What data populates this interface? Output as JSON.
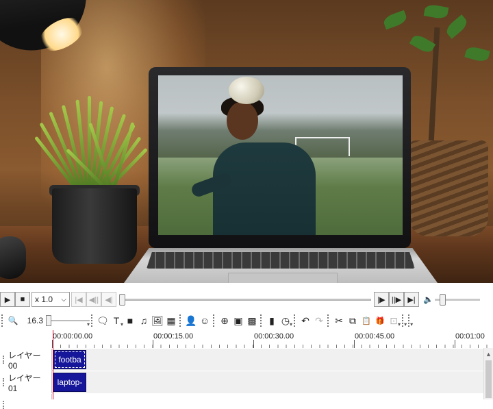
{
  "preview": {
    "description_icon": "video-preview"
  },
  "playback": {
    "speed": "x 1.0",
    "speed_caret": "⌵",
    "play_icon": "▶",
    "stop_icon": "■",
    "prev_icon": "|◀",
    "prev_frame_icon": "◀||",
    "step_back_icon": "◀|",
    "next_icon": "|▶",
    "next_frame_icon": "||▶",
    "end_icon": "▶|",
    "volume_icon": "🔈",
    "seek_position": 0.0,
    "volume_level": 0.12
  },
  "toolbar": {
    "zoom_icon": "🔍",
    "zoom_value": "16.3",
    "zoom_level": 0.0,
    "icons": {
      "subtitle": "🗨",
      "text": "T",
      "video": "■",
      "audio": "♫",
      "image": "🖼",
      "shapes": "▦",
      "person": "👤",
      "face": "☺",
      "add": "⊕",
      "picture": "▣",
      "mosaic": "▩",
      "bookmark": "▮",
      "clock": "◷",
      "undo": "↶",
      "redo": "↷",
      "cut": "✂",
      "copy": "⧉",
      "paste": "📋",
      "gift": "🎁",
      "frame": "⊡"
    }
  },
  "timeline": {
    "ticks": [
      "00:00:00.00",
      "00:00:15.00",
      "00:00:30.00",
      "00:00:45.00",
      "00:01:00"
    ],
    "layers": [
      {
        "label": "レイヤー 00",
        "clip": "footba"
      },
      {
        "label": "レイヤー 01",
        "clip": "laptop-"
      }
    ]
  }
}
